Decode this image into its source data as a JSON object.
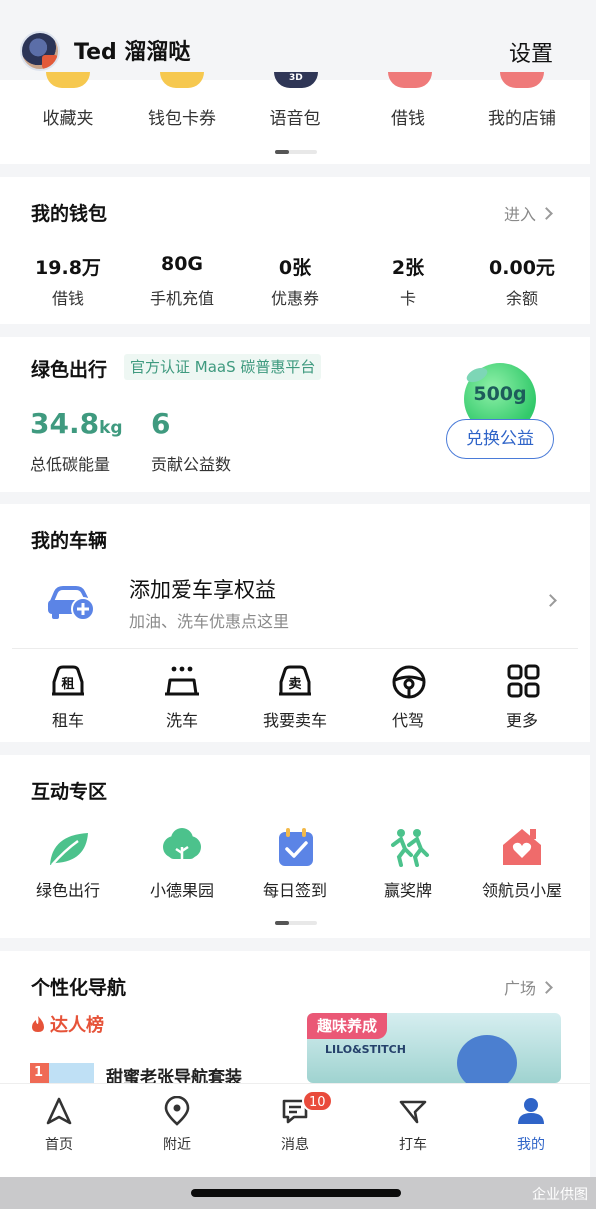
{
  "header": {
    "username": "Ted 溜溜哒",
    "settings": "设置"
  },
  "quick_menu": {
    "items": [
      "收藏夹",
      "钱包卡券",
      "语音包",
      "借钱",
      "我的店铺"
    ]
  },
  "wallet": {
    "title": "我的钱包",
    "enter": "进入",
    "stats": [
      {
        "value": "19.8万",
        "label": "借钱"
      },
      {
        "value": "80G",
        "label": "手机充值"
      },
      {
        "value": "0张",
        "label": "优惠券"
      },
      {
        "value": "2张",
        "label": "卡"
      },
      {
        "value": "0.00元",
        "label": "余额"
      }
    ]
  },
  "green": {
    "title": "绿色出行",
    "badge": "官方认证 MaaS 碳普惠平台",
    "carbon_value": "34.8",
    "carbon_unit": "kg",
    "carbon_label": "总低碳能量",
    "charity_value": "6",
    "charity_label": "贡献公益数",
    "bubble": "500g",
    "exchange": "兑换公益"
  },
  "vehicle": {
    "title": "我的车辆",
    "add_title": "添加爱车享权益",
    "add_sub": "加油、洗车优惠点这里",
    "tools": [
      "租车",
      "洗车",
      "我要卖车",
      "代驾",
      "更多"
    ],
    "rent_glyph": "租",
    "sell_glyph": "卖"
  },
  "interact": {
    "title": "互动专区",
    "items": [
      "绿色出行",
      "小德果园",
      "每日签到",
      "赢奖牌",
      "领航员小屋"
    ]
  },
  "personal_nav": {
    "title": "个性化导航",
    "plaza": "广场",
    "ranking": "达人榜",
    "rank_num": "1",
    "rank_item": "甜蜜老张导航套装",
    "promo_tag": "趣味养成",
    "promo_logo": "LILO&STITCH"
  },
  "tabbar": {
    "tabs": [
      "首页",
      "附近",
      "消息",
      "打车",
      "我的"
    ],
    "msg_badge": "10",
    "active": "我的",
    "active_color": "#2f64c8"
  },
  "watermark": "企业供图"
}
